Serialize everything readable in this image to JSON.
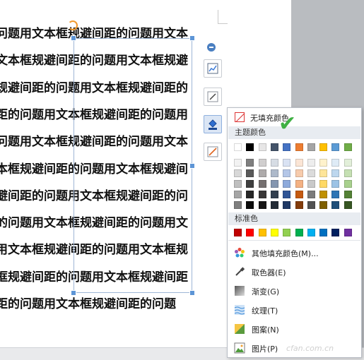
{
  "document": {
    "lines": [
      "问题用文本框规避间距的问题用文本",
      "文本框规避间距的问题用文本框规避",
      "规避间距的问题用文本框规避间距的",
      "距的问题用文本框规避间距的问题用",
      "问题用文本框规避间距的问题用文本",
      "本框规避间距的问题用文本框规避间",
      "避间距的问题用文本框规避间距的问",
      "的问题用文本框规避间距的问题用文",
      "用文本框规避间距的问题用文本框规",
      "框规避间距的问题用文本框规避间距",
      "距的问题用文本框规避间距的问题"
    ]
  },
  "fill_menu": {
    "no_fill": "无填充颜色",
    "theme_colors_header": "主题颜色",
    "standard_colors_header": "标准色",
    "theme_top_row": [
      "#ffffff",
      "#000000",
      "#e7e6e6",
      "#44546a",
      "#4472c4",
      "#ed7d31",
      "#a5a5a5",
      "#ffc000",
      "#5b9bd5",
      "#70ad47"
    ],
    "theme_shades": [
      [
        "#f2f2f2",
        "#7f7f7f",
        "#d0cece",
        "#d6dce4",
        "#d9e2f3",
        "#fbe5d5",
        "#ededed",
        "#fff2cc",
        "#deebf6",
        "#e2efd9"
      ],
      [
        "#d8d8d8",
        "#595959",
        "#aeabab",
        "#adb9ca",
        "#b4c6e7",
        "#f7cbac",
        "#dbdbdb",
        "#fee599",
        "#bdd7ee",
        "#c5e0b3"
      ],
      [
        "#bfbfbf",
        "#3f3f3f",
        "#757070",
        "#8496b0",
        "#8eaadb",
        "#f4b183",
        "#c9c9c9",
        "#ffd965",
        "#9cc3e5",
        "#a8d08d"
      ],
      [
        "#a5a5a5",
        "#262626",
        "#3a3838",
        "#323f4f",
        "#2f5496",
        "#c55a11",
        "#7b7b7b",
        "#bf9000",
        "#2e75b5",
        "#538135"
      ],
      [
        "#7f7f7f",
        "#0c0c0c",
        "#171616",
        "#222a35",
        "#1f3864",
        "#833c0b",
        "#525252",
        "#7f6000",
        "#1e4e79",
        "#375623"
      ]
    ],
    "standard_colors": [
      "#c00000",
      "#ff0000",
      "#ffc000",
      "#ffff00",
      "#92d050",
      "#00b050",
      "#00b0f0",
      "#0070c0",
      "#002060",
      "#7030a0"
    ],
    "items": [
      {
        "label": "其他填充颜色(M)...",
        "icon": "color-wheel-icon"
      },
      {
        "label": "取色器(E)",
        "icon": "eyedropper-icon"
      },
      {
        "label": "渐变(G)",
        "icon": "gradient-icon"
      },
      {
        "label": "纹理(T)",
        "icon": "texture-icon"
      },
      {
        "label": "图案(N)",
        "icon": "pattern-icon"
      },
      {
        "label": "图片(P)",
        "icon": "picture-icon"
      }
    ]
  },
  "watermark": "cfan.com.cn"
}
